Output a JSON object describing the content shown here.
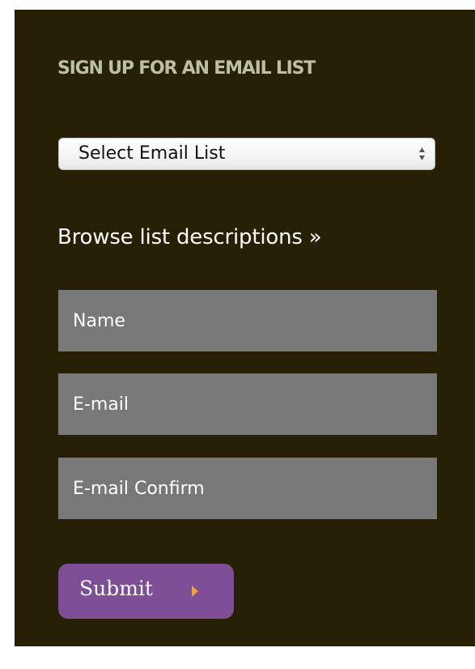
{
  "signup": {
    "heading": "SIGN UP FOR AN EMAIL LIST",
    "select": {
      "selected": "Select Email List"
    },
    "browse_link": "Browse list descriptions »",
    "fields": {
      "name_placeholder": "Name",
      "email_placeholder": "E-mail",
      "email_confirm_placeholder": "E-mail Confirm"
    },
    "submit_label": "Submit"
  },
  "colors": {
    "panel_background": "#262106",
    "heading": "#bcbfa6",
    "field_background": "#787878",
    "button_background": "#7e4f96",
    "button_arrow": "#f3a326"
  },
  "icons": {
    "select_arrows": "select-updown-arrows-icon",
    "submit_arrow": "play-right-arrow-icon"
  }
}
